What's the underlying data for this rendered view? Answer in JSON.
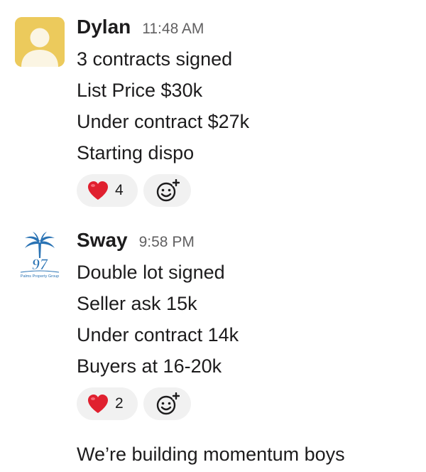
{
  "messages": [
    {
      "author": "Dylan",
      "time": "11:48 AM",
      "avatar": {
        "icon": "user-placeholder-icon",
        "bg": "#ecca5c",
        "fg": "#fbf5e3"
      },
      "lines": [
        "3 contracts signed",
        "List Price $30k",
        "Under contract $27k",
        "Starting dispo"
      ],
      "reactions": [
        {
          "emoji": "heart-icon",
          "count": "4"
        }
      ]
    },
    {
      "author": "Sway",
      "time": "9:58 PM",
      "avatar": {
        "icon": "palm-tree-logo-icon",
        "logo_number": "97",
        "logo_text": "Palms Property Group",
        "brand_color": "#2a73b4"
      },
      "lines": [
        "Double lot signed",
        "Seller ask 15k",
        "Under contract 14k",
        "Buyers at 16-20k"
      ],
      "reactions": [
        {
          "emoji": "heart-icon",
          "count": "2"
        }
      ]
    }
  ],
  "followup": {
    "text": "We’re building momentum boys"
  },
  "colors": {
    "text": "#1d1c1d",
    "timestamp": "#616061",
    "pill_bg": "#f1f1f1",
    "heart": "#e0202f"
  }
}
